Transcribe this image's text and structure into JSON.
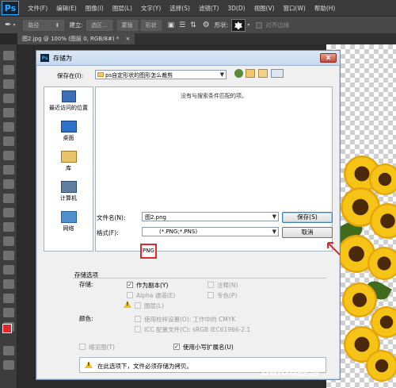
{
  "app": {
    "logo": "Ps",
    "menu": [
      "文件(F)",
      "编辑(E)",
      "图像(I)",
      "图层(L)",
      "文字(Y)",
      "选择(S)",
      "滤镜(T)",
      "3D(D)",
      "视图(V)",
      "窗口(W)",
      "帮助(H)"
    ]
  },
  "options_bar": {
    "mode": "路径",
    "make_label": "建立:",
    "selection_btn": "选区...",
    "mask_btn": "蒙版",
    "shape_btn": "形状",
    "shape_label": "形状:",
    "align_edges": "对齐边缘"
  },
  "document_tab": {
    "title": "图2.jpg @ 100% (图层 0, RGB/8#) *",
    "close": "×"
  },
  "dialog": {
    "title": "存储为",
    "close": "x",
    "save_in_label": "保存在(I):",
    "save_in_value": "ps自定形状的图形怎么裁剪",
    "empty_message": "没有与搜索条件匹配的项。",
    "places": [
      "最近访问的位置",
      "桌面",
      "库",
      "计算机",
      "网络"
    ],
    "filename_label": "文件名(N):",
    "filename_value": "图2.png",
    "format_label": "格式(F):",
    "format_value": "PNG",
    "format_rest": "(*.PNG;*.PNS)",
    "save_btn": "保存(S)",
    "cancel_btn": "取消",
    "save_options_title": "存储选项",
    "save_label": "存储:",
    "as_copy": "作为副本(Y)",
    "annotations": "注释(N)",
    "alpha_channels": "Alpha 通道(E)",
    "spot_colors": "专色(P)",
    "layers": "图层(L)",
    "color_label": "颜色:",
    "use_proof": "使用校样设置(O): 工作中的 CMYK",
    "icc_profile": "ICC 配置文件(C): sRGB IEC61966-2.1",
    "thumbnail": "缩览图(T)",
    "lowercase_ext": "使用小写扩展名(U)",
    "warning_text": "在此选项下，文件必须存储为拷贝。",
    "checks": {
      "as_copy": true,
      "lowercase_ext": true
    }
  },
  "watermark": "Baidu经验",
  "colors": {
    "accent_red": "#e0292b",
    "ps_blue": "#31a8ff"
  }
}
